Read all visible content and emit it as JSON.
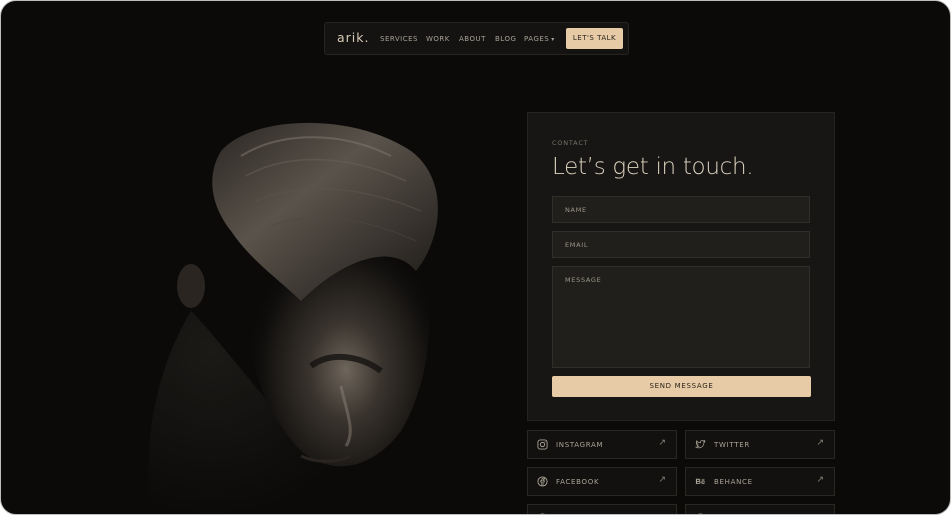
{
  "nav": {
    "logo": "arik.",
    "links": [
      "SERVICES",
      "WORK",
      "ABOUT",
      "BLOG",
      "PAGES"
    ],
    "cta_label": "LET'S TALK"
  },
  "contact": {
    "eyebrow": "CONTACT",
    "headline": "Let’s get in touch.",
    "name_placeholder": "NAME",
    "email_placeholder": "EMAIL",
    "message_placeholder": "MESSAGE",
    "send_label": "SEND MESSAGE"
  },
  "social": [
    {
      "label": "INSTAGRAM",
      "icon": "instagram-icon"
    },
    {
      "label": "TWITTER",
      "icon": "twitter-icon"
    },
    {
      "label": "FACEBOOK",
      "icon": "facebook-icon"
    },
    {
      "label": "BEHANCE",
      "icon": "behance-icon"
    }
  ],
  "colors": {
    "background": "#0b0a09",
    "accent": "#e6cba6",
    "card": "#171614",
    "text": "#ddd2bf"
  }
}
